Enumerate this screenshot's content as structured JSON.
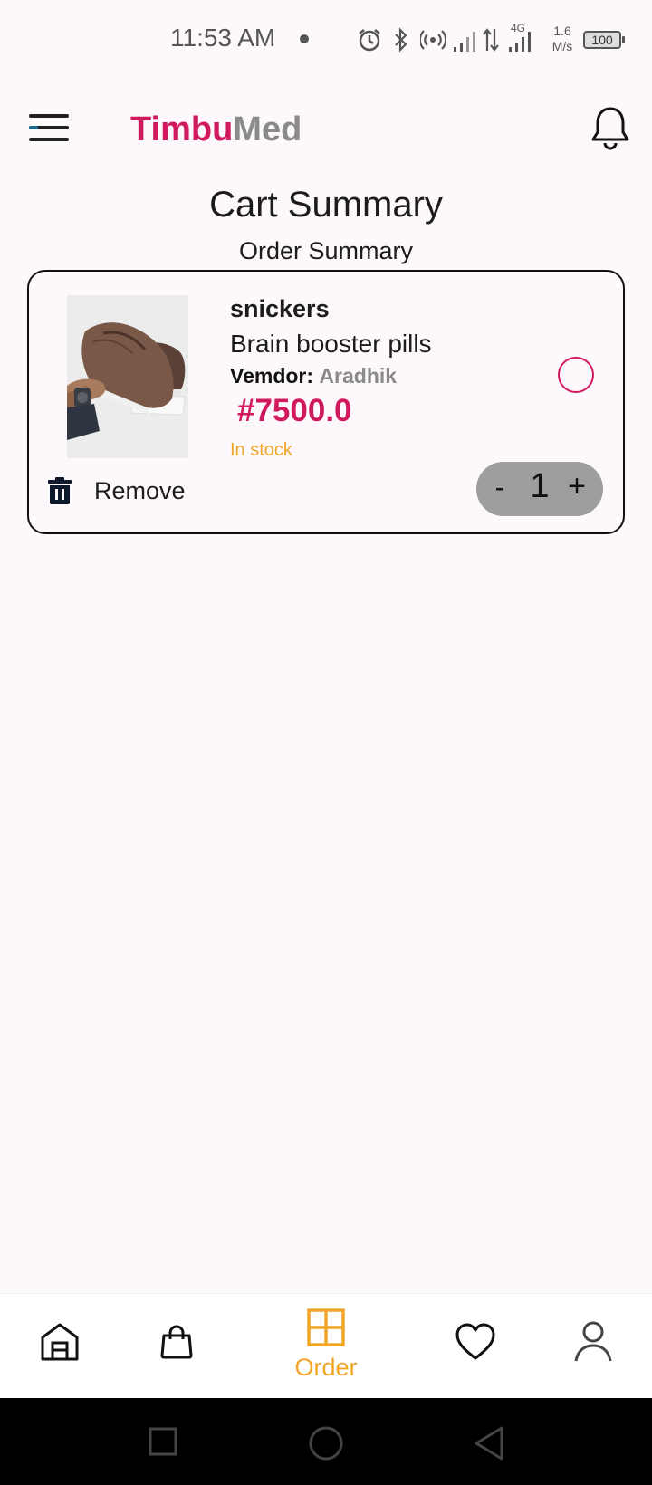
{
  "status_bar": {
    "time": "11:53 AM",
    "network_speed_value": "1.6",
    "network_speed_unit": "M/s",
    "network_type": "4G",
    "battery": "100"
  },
  "header": {
    "brand_part1": "Timbu",
    "brand_part2": "Med",
    "brand_color1": "#d0195e",
    "brand_color2": "#8a8a8a"
  },
  "page": {
    "title": "Cart Summary",
    "subtitle": "Order Summary"
  },
  "cart_items": [
    {
      "name": "snickers",
      "description": "Brain booster pills",
      "vendor_label": "Vemdor:",
      "vendor_name": "Aradhik",
      "price": "#7500.0",
      "stock_status": "In stock",
      "remove_label": "Remove",
      "quantity": "1",
      "minus_label": "-",
      "plus_label": "+"
    }
  ],
  "bottom_nav": {
    "items": [
      {
        "icon": "home-icon",
        "label": ""
      },
      {
        "icon": "shopping-bag-icon",
        "label": ""
      },
      {
        "icon": "grid-icon",
        "label": "Order",
        "active": true
      },
      {
        "icon": "heart-icon",
        "label": ""
      },
      {
        "icon": "user-icon",
        "label": ""
      }
    ],
    "active_color": "#f0a629"
  },
  "system_nav": {
    "buttons": [
      "recents-icon",
      "home-circle-icon",
      "back-icon"
    ]
  }
}
